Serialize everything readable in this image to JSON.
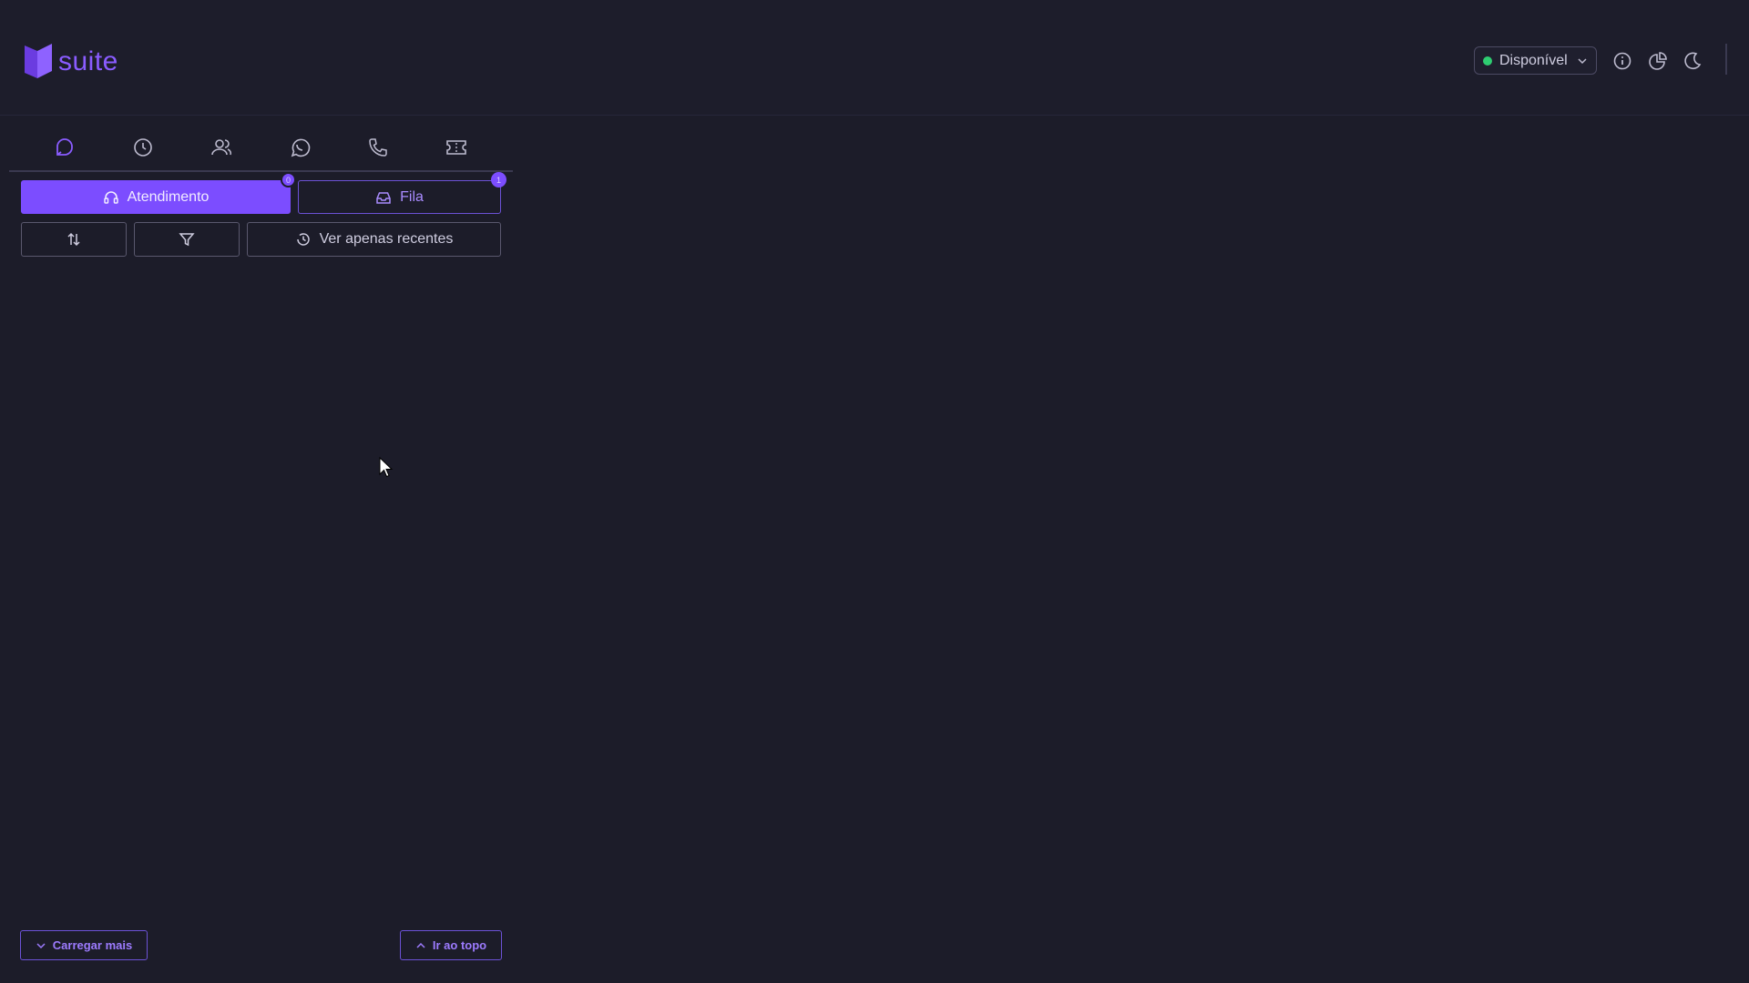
{
  "brand": {
    "name": "suite",
    "color": "#8a5cff"
  },
  "header": {
    "status": {
      "label": "Disponível",
      "color": "#2ecc71"
    },
    "icons": [
      "info-icon",
      "pie-chart-icon",
      "moon-icon"
    ]
  },
  "panel": {
    "tabs": [
      {
        "name": "chat-bubble-icon",
        "active": true
      },
      {
        "name": "clock-icon",
        "active": false
      },
      {
        "name": "contacts-icon",
        "active": false
      },
      {
        "name": "whatsapp-icon",
        "active": false
      },
      {
        "name": "phone-icon",
        "active": false
      },
      {
        "name": "ticket-icon",
        "active": false
      }
    ],
    "segments": {
      "atendimento": {
        "label": "Atendimento",
        "badge": "0"
      },
      "fila": {
        "label": "Fila",
        "badge": "1"
      }
    },
    "toolbar": {
      "sort_icon": "sort-arrows-icon",
      "filter_icon": "filter-icon",
      "recent_label": "Ver apenas recentes"
    },
    "footer": {
      "load_more_label": "Carregar mais",
      "to_top_label": "Ir ao topo"
    }
  },
  "colors": {
    "accent": "#7c4dff",
    "background": "#1c1c29",
    "border": "#5a586e"
  }
}
